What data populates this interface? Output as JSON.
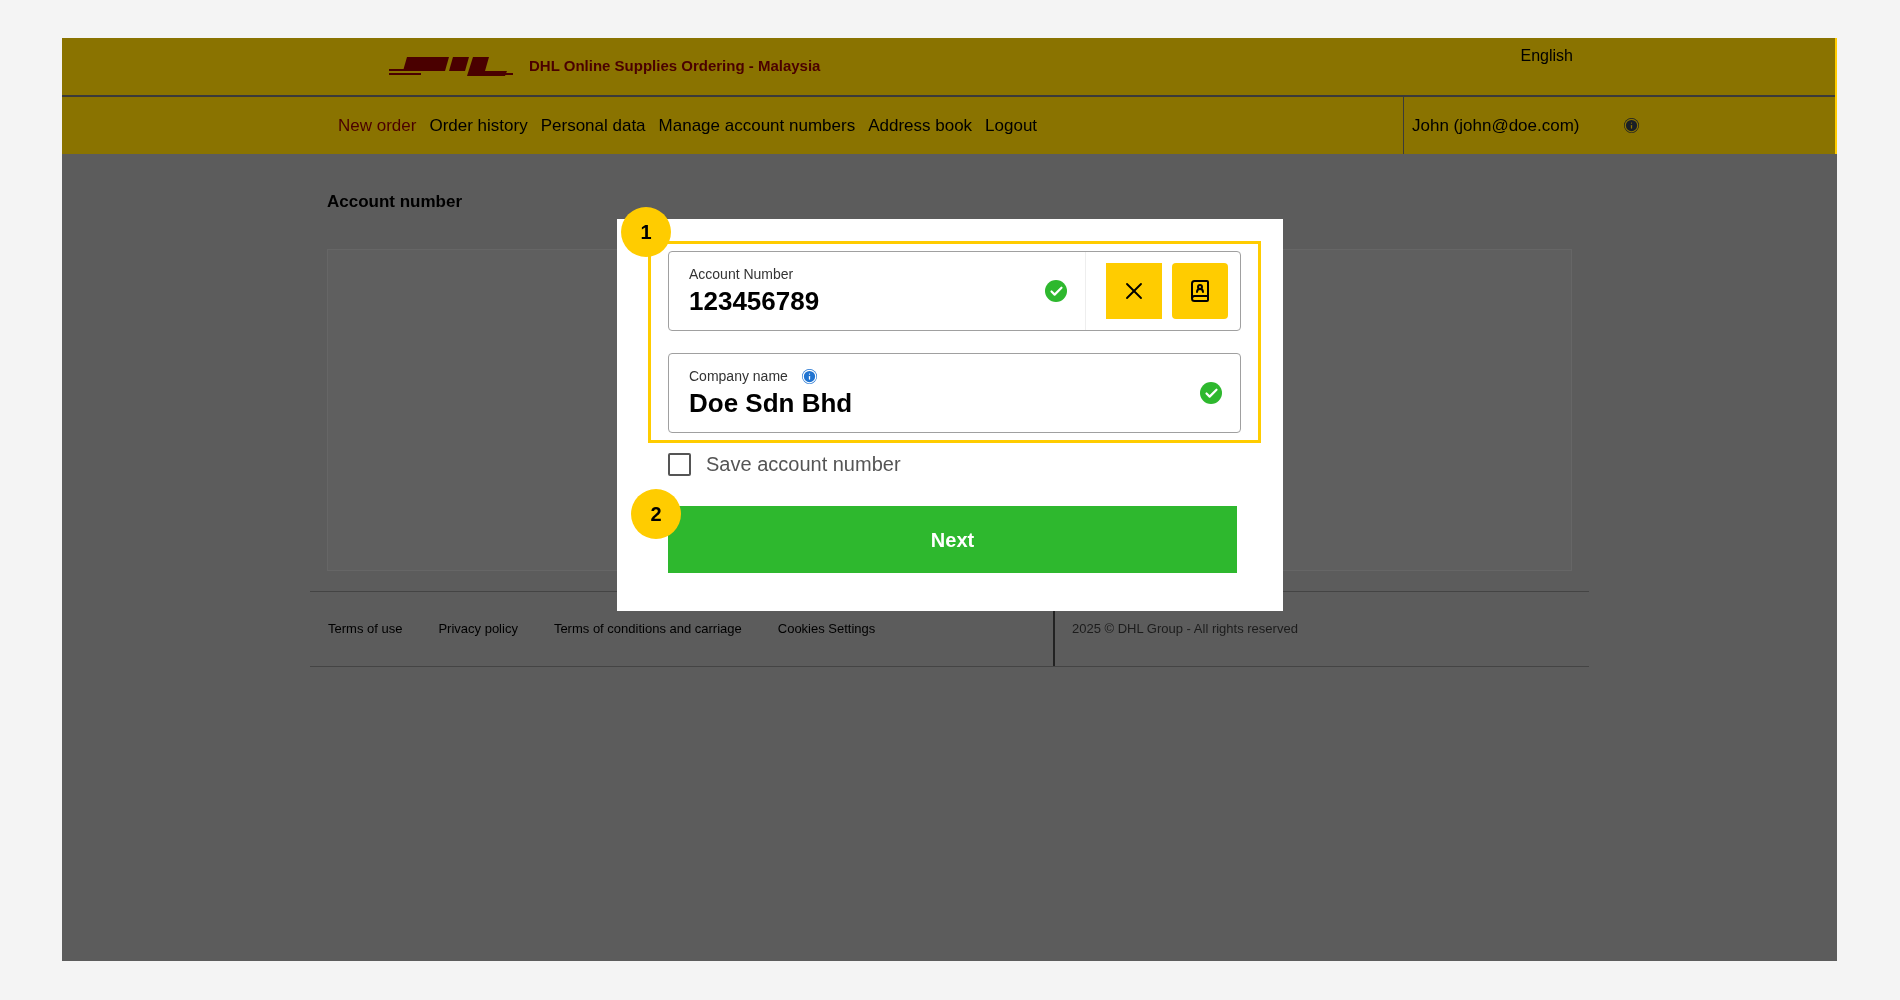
{
  "header": {
    "title": "DHL Online Supplies Ordering - Malaysia",
    "language": "English"
  },
  "nav": [
    {
      "label": "New order",
      "selected": true
    },
    {
      "label": "Order history",
      "selected": false
    },
    {
      "label": "Personal data",
      "selected": false
    },
    {
      "label": "Manage account numbers",
      "selected": false
    },
    {
      "label": "Address book",
      "selected": false
    },
    {
      "label": "Logout",
      "selected": false
    }
  ],
  "user": "John (john@doe.com)",
  "page_title": "Account number",
  "dialog": {
    "markers": [
      "1",
      "2"
    ],
    "fields": [
      {
        "kind": "account",
        "label": "Account Number",
        "value": "123456789",
        "valid": true
      },
      {
        "kind": "company",
        "label": "Company name",
        "value": "Doe Sdn Bhd",
        "valid": true
      }
    ],
    "checkbox": {
      "label": "Save account number",
      "checked": false
    },
    "button": "Next"
  },
  "footer": {
    "links": [
      "Terms of use",
      "Privacy policy",
      "Terms of conditions and carriage",
      "Cookies Settings"
    ],
    "copyright": "2025 © DHL Group - All rights reserved"
  }
}
